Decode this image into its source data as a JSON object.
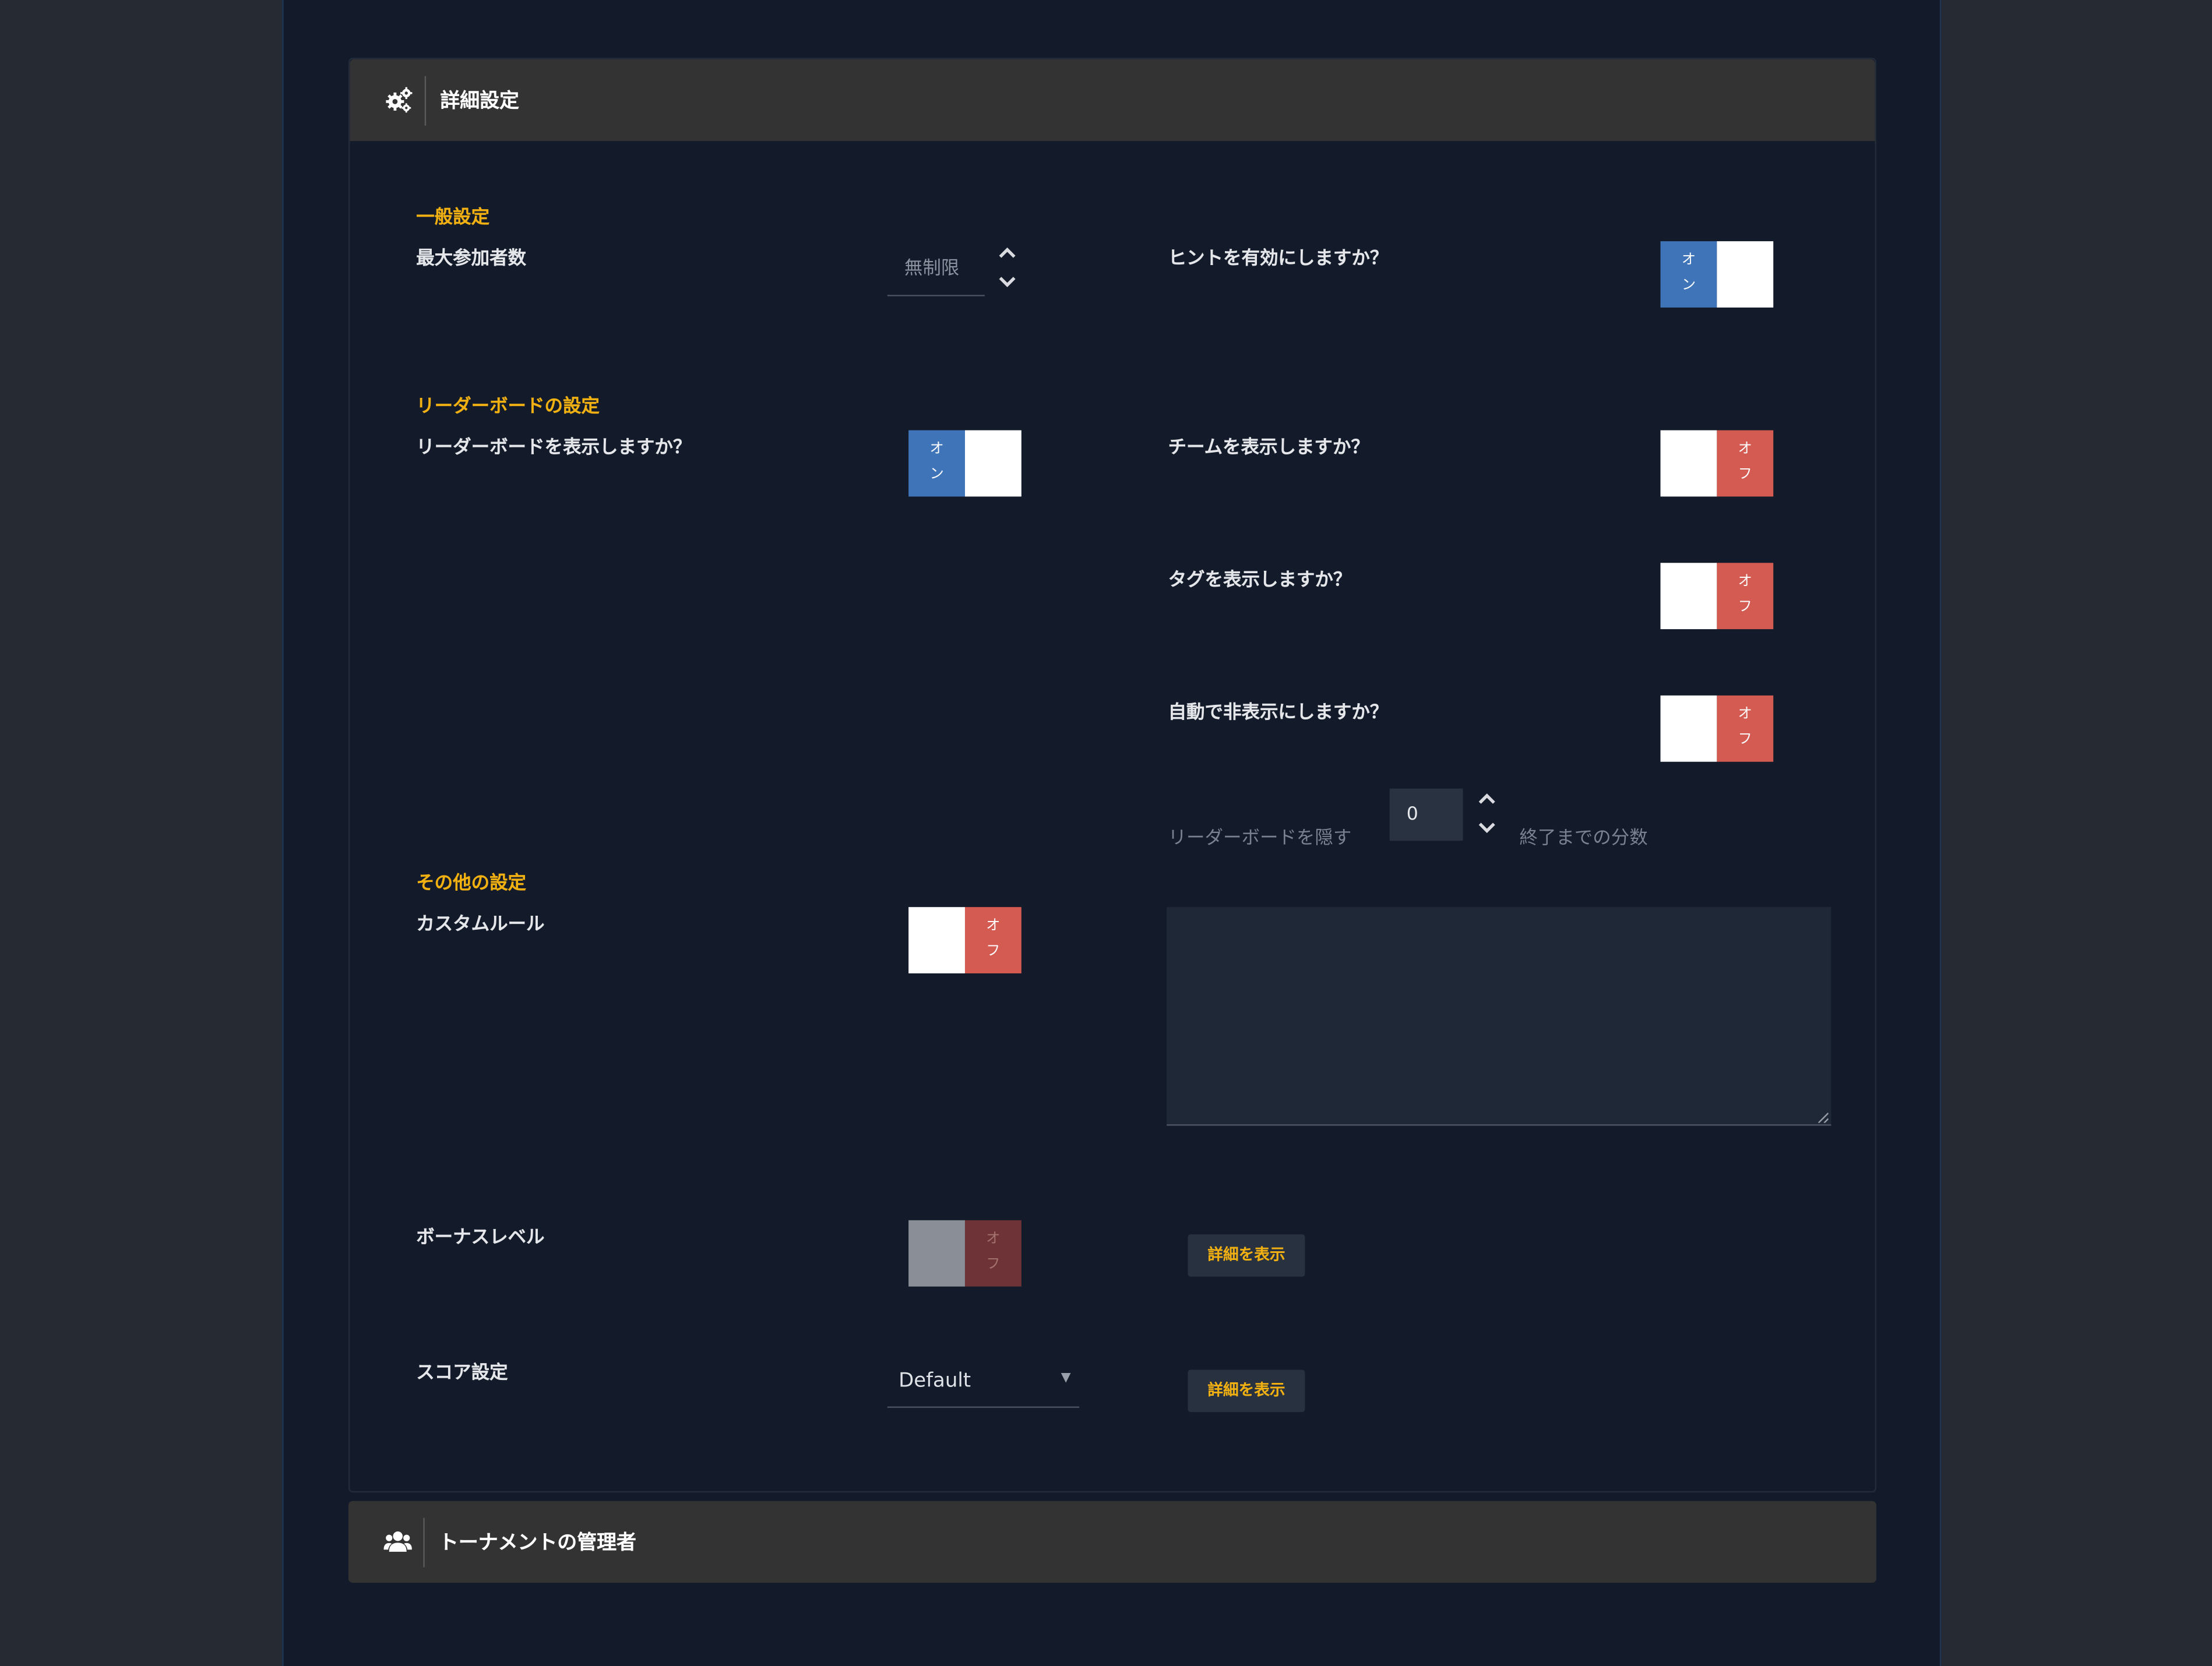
{
  "settings_panel": {
    "title": "詳細設定",
    "icon": "gears-icon",
    "general": {
      "section_title": "一般設定",
      "max_participants": {
        "label": "最大参加者数",
        "placeholder": "無制限"
      },
      "hints": {
        "label": "ヒントを有効にしますか？",
        "state": "on",
        "on_text": "オン"
      }
    },
    "leaderboard": {
      "section_title": "リーダーボードの設定",
      "show_leaderboard": {
        "label": "リーダーボードを表示しますか？",
        "state": "on",
        "on_text": "オン"
      },
      "show_teams": {
        "label": "チームを表示しますか？",
        "state": "off",
        "off_text": "オフ"
      },
      "show_tags": {
        "label": "タグを表示しますか？",
        "state": "off",
        "off_text": "オフ"
      },
      "auto_hide": {
        "label": "自動で非表示にしますか？",
        "state": "off",
        "off_text": "オフ"
      },
      "hide_leaderboard": {
        "prefix": "リーダーボードを隠す",
        "value": "0",
        "suffix": "終了までの分数"
      }
    },
    "other": {
      "section_title": "その他の設定",
      "custom_rules": {
        "label": "カスタムルール",
        "state": "off",
        "off_text": "オフ",
        "text": ""
      },
      "bonus_levels": {
        "label": "ボーナスレベル",
        "state": "off",
        "disabled": true,
        "off_text": "オフ",
        "details_button": "詳細を表示"
      },
      "scoring": {
        "label": "スコア設定",
        "selected": "Default",
        "details_button": "詳細を表示"
      }
    }
  },
  "managers_panel": {
    "title": "トーナメントの管理者",
    "icon": "users-icon"
  },
  "colors": {
    "accent": "#f0b012",
    "toggle_on": "#3f75b8",
    "toggle_off": "#d35b52",
    "panel_header": "#333333",
    "background": "#131b2a"
  }
}
